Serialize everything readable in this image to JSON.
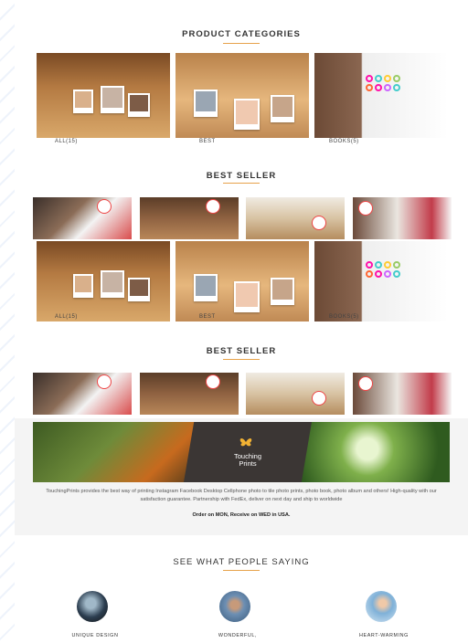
{
  "categories": {
    "title": "PRODUCT CATEGORIES",
    "items": [
      {
        "label": "ALL(15)"
      },
      {
        "label": "BEST"
      },
      {
        "label": "BOOKS(5)"
      }
    ]
  },
  "best_seller_1": {
    "title": "BEST SELLER",
    "captions": [
      "ALL(15)",
      "BEST",
      "BOOKS(5)"
    ]
  },
  "best_seller_2": {
    "title": "BEST SELLER"
  },
  "banner": {
    "logo_line1": "Touching",
    "logo_line2": "Prints",
    "description": "TouchingPrints provides the best way of printing Instagram Facebook Desktop Cellphone photo to tile photo prints, photo book, photo album and others! High-quality with our satisfaction guarantee. Partnership with FedEx, deliver on next day and ship to worldwide",
    "order_note": "Order on MON, Receive on WED in USA."
  },
  "testimonials": {
    "title": "SEE WHAT PEOPLE SAYING",
    "items": [
      {
        "label": "UNIQUE DESIGN"
      },
      {
        "label": "WONDERFUL,"
      },
      {
        "label": "HEART-WARMING"
      }
    ]
  },
  "colors": {
    "accent": "#e7a24a",
    "badge": "#e44444"
  }
}
